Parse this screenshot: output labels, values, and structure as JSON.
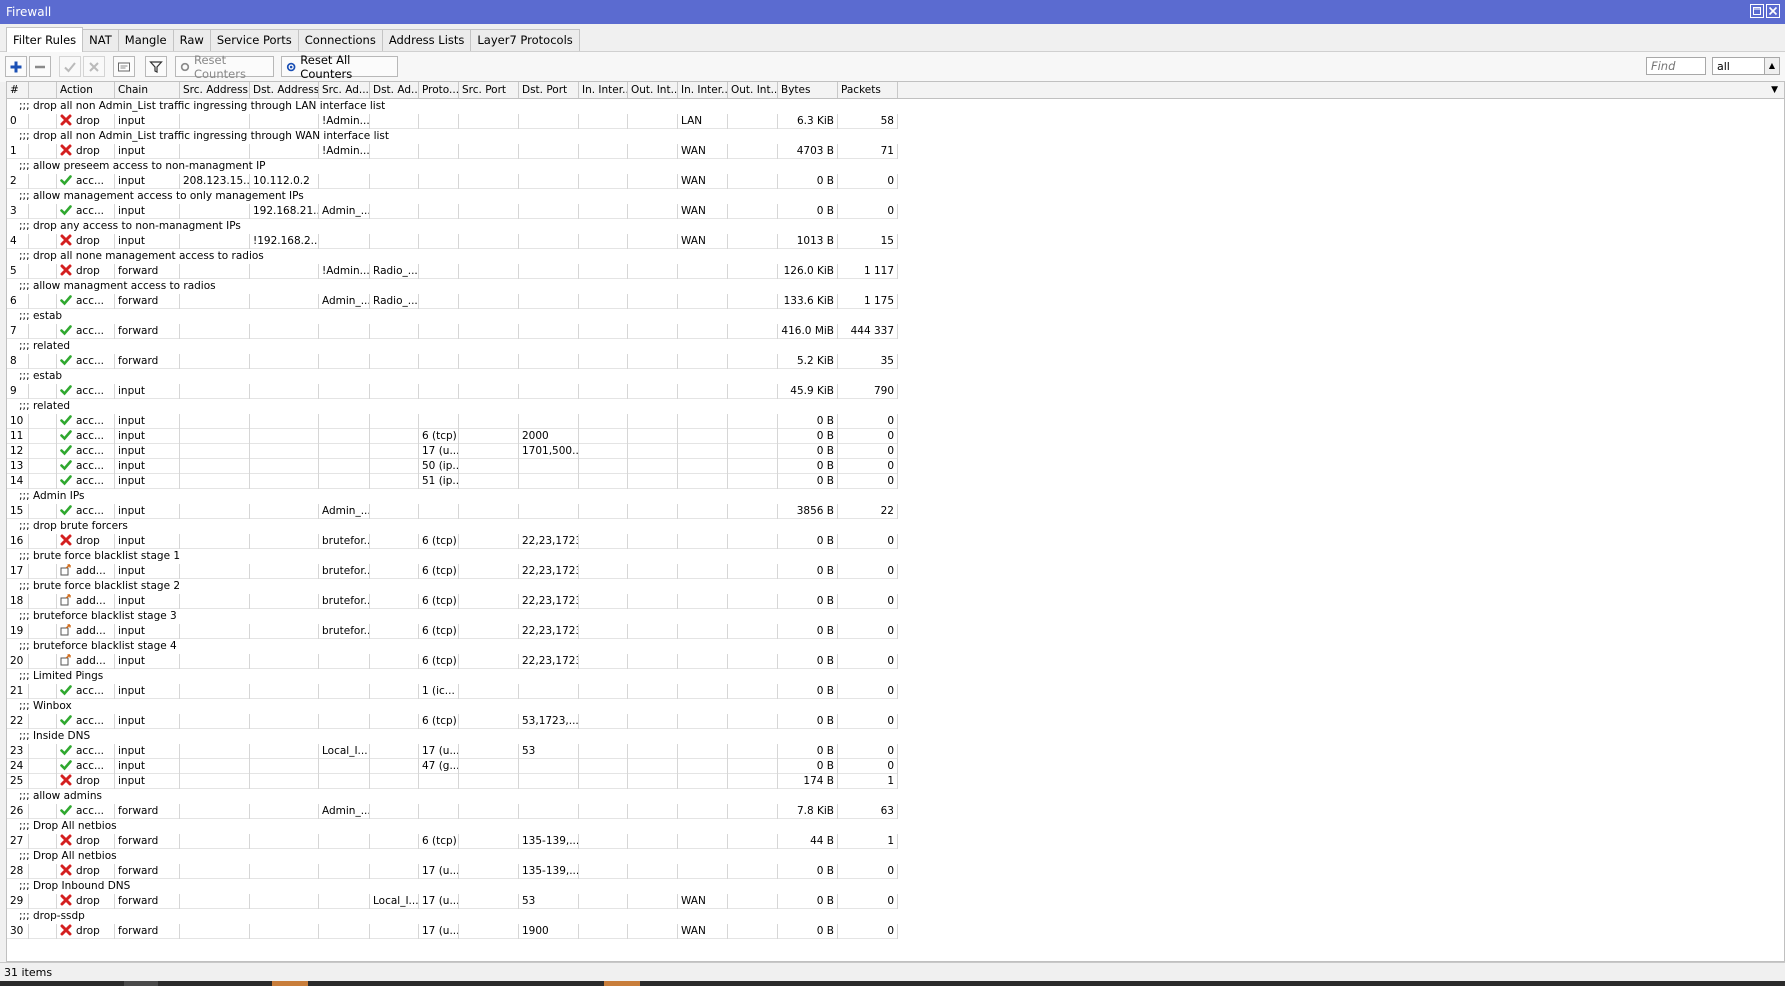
{
  "window": {
    "title": "Firewall"
  },
  "tabs": [
    {
      "label": "Filter Rules",
      "active": true
    },
    {
      "label": "NAT"
    },
    {
      "label": "Mangle"
    },
    {
      "label": "Raw"
    },
    {
      "label": "Service Ports"
    },
    {
      "label": "Connections"
    },
    {
      "label": "Address Lists"
    },
    {
      "label": "Layer7 Protocols"
    }
  ],
  "toolbar": {
    "reset_counters_label": "Reset Counters",
    "reset_all_counters_label": "Reset All Counters",
    "find_placeholder": "Find",
    "filter_select_value": "all"
  },
  "columns": [
    "#",
    "",
    "Action",
    "Chain",
    "Src. Address",
    "Dst. Address",
    "Src. Ad...",
    "Dst. Ad...",
    "Proto...",
    "Src. Port",
    "Dst. Port",
    "In. Inter...",
    "Out. Int...",
    "In. Inter...",
    "Out. Int...",
    "Bytes",
    "Packets"
  ],
  "rules": [
    {
      "comment": ";;; drop all non Admin_List traffic ingressing through LAN interface list",
      "num": "0",
      "action": "drop",
      "chain": "input",
      "src_addr": "",
      "dst_addr": "",
      "src_list": "!Admin...",
      "dst_list": "",
      "proto": "",
      "src_port": "",
      "dst_port": "",
      "in_if": "",
      "out_if": "",
      "in_if_list": "LAN",
      "out_if_list": "",
      "bytes": "6.3 KiB",
      "packets": "58"
    },
    {
      "comment": ";;; drop all non Admin_List traffic ingressing through WAN interface list",
      "num": "1",
      "action": "drop",
      "chain": "input",
      "src_addr": "",
      "dst_addr": "",
      "src_list": "!Admin...",
      "dst_list": "",
      "proto": "",
      "src_port": "",
      "dst_port": "",
      "in_if": "",
      "out_if": "",
      "in_if_list": "WAN",
      "out_if_list": "",
      "bytes": "4703 B",
      "packets": "71"
    },
    {
      "comment": ";;; allow preseem access to non-managment IP",
      "num": "2",
      "action": "acc...",
      "chain": "input",
      "src_addr": "208.123.15...",
      "dst_addr": "10.112.0.2",
      "src_list": "",
      "dst_list": "",
      "proto": "",
      "src_port": "",
      "dst_port": "",
      "in_if": "",
      "out_if": "",
      "in_if_list": "WAN",
      "out_if_list": "",
      "bytes": "0 B",
      "packets": "0"
    },
    {
      "comment": ";;; allow management access to only management IPs",
      "num": "3",
      "action": "acc...",
      "chain": "input",
      "src_addr": "",
      "dst_addr": "192.168.21...",
      "src_list": "Admin_...",
      "dst_list": "",
      "proto": "",
      "src_port": "",
      "dst_port": "",
      "in_if": "",
      "out_if": "",
      "in_if_list": "WAN",
      "out_if_list": "",
      "bytes": "0 B",
      "packets": "0"
    },
    {
      "comment": ";;; drop any access to non-managment IPs",
      "num": "4",
      "action": "drop",
      "chain": "input",
      "src_addr": "",
      "dst_addr": "!192.168.2...",
      "src_list": "",
      "dst_list": "",
      "proto": "",
      "src_port": "",
      "dst_port": "",
      "in_if": "",
      "out_if": "",
      "in_if_list": "WAN",
      "out_if_list": "",
      "bytes": "1013 B",
      "packets": "15"
    },
    {
      "comment": ";;; drop all none management access to radios",
      "num": "5",
      "action": "drop",
      "chain": "forward",
      "src_addr": "",
      "dst_addr": "",
      "src_list": "!Admin...",
      "dst_list": "Radio_...",
      "proto": "",
      "src_port": "",
      "dst_port": "",
      "in_if": "",
      "out_if": "",
      "in_if_list": "",
      "out_if_list": "",
      "bytes": "126.0 KiB",
      "packets": "1 117"
    },
    {
      "comment": ";;; allow managment access to radios",
      "num": "6",
      "action": "acc...",
      "chain": "forward",
      "src_addr": "",
      "dst_addr": "",
      "src_list": "Admin_...",
      "dst_list": "Radio_...",
      "proto": "",
      "src_port": "",
      "dst_port": "",
      "in_if": "",
      "out_if": "",
      "in_if_list": "",
      "out_if_list": "",
      "bytes": "133.6 KiB",
      "packets": "1 175"
    },
    {
      "comment": ";;; estab",
      "num": "7",
      "action": "acc...",
      "chain": "forward",
      "src_addr": "",
      "dst_addr": "",
      "src_list": "",
      "dst_list": "",
      "proto": "",
      "src_port": "",
      "dst_port": "",
      "in_if": "",
      "out_if": "",
      "in_if_list": "",
      "out_if_list": "",
      "bytes": "416.0 MiB",
      "packets": "444 337"
    },
    {
      "comment": ";;; related",
      "num": "8",
      "action": "acc...",
      "chain": "forward",
      "src_addr": "",
      "dst_addr": "",
      "src_list": "",
      "dst_list": "",
      "proto": "",
      "src_port": "",
      "dst_port": "",
      "in_if": "",
      "out_if": "",
      "in_if_list": "",
      "out_if_list": "",
      "bytes": "5.2 KiB",
      "packets": "35"
    },
    {
      "comment": ";;; estab",
      "num": "9",
      "action": "acc...",
      "chain": "input",
      "src_addr": "",
      "dst_addr": "",
      "src_list": "",
      "dst_list": "",
      "proto": "",
      "src_port": "",
      "dst_port": "",
      "in_if": "",
      "out_if": "",
      "in_if_list": "",
      "out_if_list": "",
      "bytes": "45.9 KiB",
      "packets": "790"
    },
    {
      "comment": ";;; related",
      "num": "10",
      "action": "acc...",
      "chain": "input",
      "src_addr": "",
      "dst_addr": "",
      "src_list": "",
      "dst_list": "",
      "proto": "",
      "src_port": "",
      "dst_port": "",
      "in_if": "",
      "out_if": "",
      "in_if_list": "",
      "out_if_list": "",
      "bytes": "0 B",
      "packets": "0"
    },
    {
      "comment": "",
      "num": "11",
      "action": "acc...",
      "chain": "input",
      "src_addr": "",
      "dst_addr": "",
      "src_list": "",
      "dst_list": "",
      "proto": "6 (tcp)",
      "src_port": "",
      "dst_port": "2000",
      "in_if": "",
      "out_if": "",
      "in_if_list": "",
      "out_if_list": "",
      "bytes": "0 B",
      "packets": "0"
    },
    {
      "comment": "",
      "num": "12",
      "action": "acc...",
      "chain": "input",
      "src_addr": "",
      "dst_addr": "",
      "src_list": "",
      "dst_list": "",
      "proto": "17 (u...",
      "src_port": "",
      "dst_port": "1701,500...",
      "in_if": "",
      "out_if": "",
      "in_if_list": "",
      "out_if_list": "",
      "bytes": "0 B",
      "packets": "0"
    },
    {
      "comment": "",
      "num": "13",
      "action": "acc...",
      "chain": "input",
      "src_addr": "",
      "dst_addr": "",
      "src_list": "",
      "dst_list": "",
      "proto": "50 (ip...",
      "src_port": "",
      "dst_port": "",
      "in_if": "",
      "out_if": "",
      "in_if_list": "",
      "out_if_list": "",
      "bytes": "0 B",
      "packets": "0"
    },
    {
      "comment": "",
      "num": "14",
      "action": "acc...",
      "chain": "input",
      "src_addr": "",
      "dst_addr": "",
      "src_list": "",
      "dst_list": "",
      "proto": "51 (ip...",
      "src_port": "",
      "dst_port": "",
      "in_if": "",
      "out_if": "",
      "in_if_list": "",
      "out_if_list": "",
      "bytes": "0 B",
      "packets": "0"
    },
    {
      "comment": ";;; Admin IPs",
      "num": "15",
      "action": "acc...",
      "chain": "input",
      "src_addr": "",
      "dst_addr": "",
      "src_list": "Admin_...",
      "dst_list": "",
      "proto": "",
      "src_port": "",
      "dst_port": "",
      "in_if": "",
      "out_if": "",
      "in_if_list": "",
      "out_if_list": "",
      "bytes": "3856 B",
      "packets": "22"
    },
    {
      "comment": ";;; drop brute forcers",
      "num": "16",
      "action": "drop",
      "chain": "input",
      "src_addr": "",
      "dst_addr": "",
      "src_list": "brutefor...",
      "dst_list": "",
      "proto": "6 (tcp)",
      "src_port": "",
      "dst_port": "22,23,1723",
      "in_if": "",
      "out_if": "",
      "in_if_list": "",
      "out_if_list": "",
      "bytes": "0 B",
      "packets": "0"
    },
    {
      "comment": ";;; brute force blacklist stage 1",
      "num": "17",
      "action": "add...",
      "chain": "input",
      "src_addr": "",
      "dst_addr": "",
      "src_list": "brutefor...",
      "dst_list": "",
      "proto": "6 (tcp)",
      "src_port": "",
      "dst_port": "22,23,1723",
      "in_if": "",
      "out_if": "",
      "in_if_list": "",
      "out_if_list": "",
      "bytes": "0 B",
      "packets": "0"
    },
    {
      "comment": ";;; brute force blacklist stage 2",
      "num": "18",
      "action": "add...",
      "chain": "input",
      "src_addr": "",
      "dst_addr": "",
      "src_list": "brutefor...",
      "dst_list": "",
      "proto": "6 (tcp)",
      "src_port": "",
      "dst_port": "22,23,1723",
      "in_if": "",
      "out_if": "",
      "in_if_list": "",
      "out_if_list": "",
      "bytes": "0 B",
      "packets": "0"
    },
    {
      "comment": ";;; bruteforce blacklist stage 3",
      "num": "19",
      "action": "add...",
      "chain": "input",
      "src_addr": "",
      "dst_addr": "",
      "src_list": "brutefor...",
      "dst_list": "",
      "proto": "6 (tcp)",
      "src_port": "",
      "dst_port": "22,23,1723",
      "in_if": "",
      "out_if": "",
      "in_if_list": "",
      "out_if_list": "",
      "bytes": "0 B",
      "packets": "0"
    },
    {
      "comment": ";;; bruteforce blacklist stage 4",
      "num": "20",
      "action": "add...",
      "chain": "input",
      "src_addr": "",
      "dst_addr": "",
      "src_list": "",
      "dst_list": "",
      "proto": "6 (tcp)",
      "src_port": "",
      "dst_port": "22,23,1723",
      "in_if": "",
      "out_if": "",
      "in_if_list": "",
      "out_if_list": "",
      "bytes": "0 B",
      "packets": "0"
    },
    {
      "comment": ";;; Limited Pings",
      "num": "21",
      "action": "acc...",
      "chain": "input",
      "src_addr": "",
      "dst_addr": "",
      "src_list": "",
      "dst_list": "",
      "proto": "1 (ic...",
      "src_port": "",
      "dst_port": "",
      "in_if": "",
      "out_if": "",
      "in_if_list": "",
      "out_if_list": "",
      "bytes": "0 B",
      "packets": "0"
    },
    {
      "comment": ";;; Winbox",
      "num": "22",
      "action": "acc...",
      "chain": "input",
      "src_addr": "",
      "dst_addr": "",
      "src_list": "",
      "dst_list": "",
      "proto": "6 (tcp)",
      "src_port": "",
      "dst_port": "53,1723,...",
      "in_if": "",
      "out_if": "",
      "in_if_list": "",
      "out_if_list": "",
      "bytes": "0 B",
      "packets": "0"
    },
    {
      "comment": ";;; Inside DNS",
      "num": "23",
      "action": "acc...",
      "chain": "input",
      "src_addr": "",
      "dst_addr": "",
      "src_list": "Local_I...",
      "dst_list": "",
      "proto": "17 (u...",
      "src_port": "",
      "dst_port": "53",
      "in_if": "",
      "out_if": "",
      "in_if_list": "",
      "out_if_list": "",
      "bytes": "0 B",
      "packets": "0"
    },
    {
      "comment": "",
      "num": "24",
      "action": "acc...",
      "chain": "input",
      "src_addr": "",
      "dst_addr": "",
      "src_list": "",
      "dst_list": "",
      "proto": "47 (g...",
      "src_port": "",
      "dst_port": "",
      "in_if": "",
      "out_if": "",
      "in_if_list": "",
      "out_if_list": "",
      "bytes": "0 B",
      "packets": "0"
    },
    {
      "comment": "",
      "num": "25",
      "action": "drop",
      "chain": "input",
      "src_addr": "",
      "dst_addr": "",
      "src_list": "",
      "dst_list": "",
      "proto": "",
      "src_port": "",
      "dst_port": "",
      "in_if": "",
      "out_if": "",
      "in_if_list": "",
      "out_if_list": "",
      "bytes": "174 B",
      "packets": "1"
    },
    {
      "comment": ";;; allow admins",
      "num": "26",
      "action": "acc...",
      "chain": "forward",
      "src_addr": "",
      "dst_addr": "",
      "src_list": "Admin_...",
      "dst_list": "",
      "proto": "",
      "src_port": "",
      "dst_port": "",
      "in_if": "",
      "out_if": "",
      "in_if_list": "",
      "out_if_list": "",
      "bytes": "7.8 KiB",
      "packets": "63"
    },
    {
      "comment": ";;; Drop All netbios",
      "num": "27",
      "action": "drop",
      "chain": "forward",
      "src_addr": "",
      "dst_addr": "",
      "src_list": "",
      "dst_list": "",
      "proto": "6 (tcp)",
      "src_port": "",
      "dst_port": "135-139,...",
      "in_if": "",
      "out_if": "",
      "in_if_list": "",
      "out_if_list": "",
      "bytes": "44 B",
      "packets": "1"
    },
    {
      "comment": ";;; Drop All netbios",
      "num": "28",
      "action": "drop",
      "chain": "forward",
      "src_addr": "",
      "dst_addr": "",
      "src_list": "",
      "dst_list": "",
      "proto": "17 (u...",
      "src_port": "",
      "dst_port": "135-139,...",
      "in_if": "",
      "out_if": "",
      "in_if_list": "",
      "out_if_list": "",
      "bytes": "0 B",
      "packets": "0"
    },
    {
      "comment": ";;; Drop Inbound DNS",
      "num": "29",
      "action": "drop",
      "chain": "forward",
      "src_addr": "",
      "dst_addr": "",
      "src_list": "",
      "dst_list": "Local_I...",
      "proto": "17 (u...",
      "src_port": "",
      "dst_port": "53",
      "in_if": "",
      "out_if": "",
      "in_if_list": "WAN",
      "out_if_list": "",
      "bytes": "0 B",
      "packets": "0"
    },
    {
      "comment": ";;; drop-ssdp",
      "num": "30",
      "action": "drop",
      "chain": "forward",
      "src_addr": "",
      "dst_addr": "",
      "src_list": "",
      "dst_list": "",
      "proto": "17 (u...",
      "src_port": "",
      "dst_port": "1900",
      "in_if": "",
      "out_if": "",
      "in_if_list": "WAN",
      "out_if_list": "",
      "bytes": "0 B",
      "packets": "0"
    }
  ],
  "status": {
    "item_count": "31 items"
  },
  "colors": {
    "titlebar": "#5b6bd0",
    "drop_icon": "#d42020",
    "accept_icon": "#2fa82f",
    "add_icon": "#d06a18"
  }
}
